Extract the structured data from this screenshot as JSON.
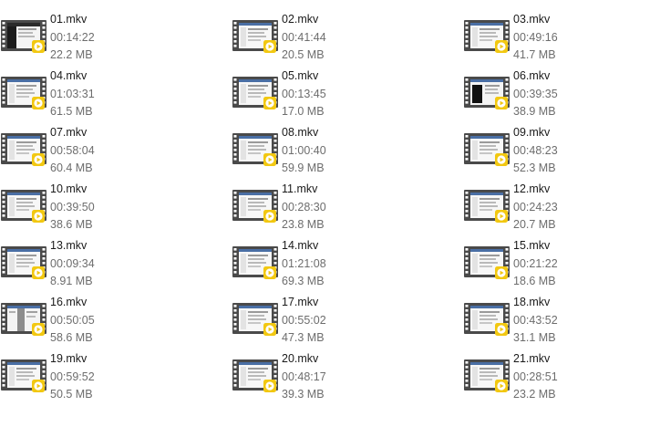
{
  "files": [
    {
      "name": "01.mkv",
      "duration": "00:14:22",
      "size": "22.2 MB",
      "thumb": "dark-mixed"
    },
    {
      "name": "02.mkv",
      "duration": "00:41:44",
      "size": "20.5 MB",
      "thumb": "light"
    },
    {
      "name": "03.mkv",
      "duration": "00:49:16",
      "size": "41.7 MB",
      "thumb": "light"
    },
    {
      "name": "04.mkv",
      "duration": "01:03:31",
      "size": "61.5 MB",
      "thumb": "light"
    },
    {
      "name": "05.mkv",
      "duration": "00:13:45",
      "size": "17.0 MB",
      "thumb": "light"
    },
    {
      "name": "06.mkv",
      "duration": "00:39:35",
      "size": "38.9 MB",
      "thumb": "dark-left"
    },
    {
      "name": "07.mkv",
      "duration": "00:58:04",
      "size": "60.4 MB",
      "thumb": "light"
    },
    {
      "name": "08.mkv",
      "duration": "01:00:40",
      "size": "59.9 MB",
      "thumb": "light"
    },
    {
      "name": "09.mkv",
      "duration": "00:48:23",
      "size": "52.3 MB",
      "thumb": "light"
    },
    {
      "name": "10.mkv",
      "duration": "00:39:50",
      "size": "38.6 MB",
      "thumb": "light"
    },
    {
      "name": "11.mkv",
      "duration": "00:28:30",
      "size": "23.8 MB",
      "thumb": "light"
    },
    {
      "name": "12.mkv",
      "duration": "00:24:23",
      "size": "20.7 MB",
      "thumb": "light"
    },
    {
      "name": "13.mkv",
      "duration": "00:09:34",
      "size": "8.91 MB",
      "thumb": "light"
    },
    {
      "name": "14.mkv",
      "duration": "01:21:08",
      "size": "69.3 MB",
      "thumb": "light"
    },
    {
      "name": "15.mkv",
      "duration": "00:21:22",
      "size": "18.6 MB",
      "thumb": "light"
    },
    {
      "name": "16.mkv",
      "duration": "00:50:05",
      "size": "58.6 MB",
      "thumb": "gray-mid"
    },
    {
      "name": "17.mkv",
      "duration": "00:55:02",
      "size": "47.3 MB",
      "thumb": "light"
    },
    {
      "name": "18.mkv",
      "duration": "00:43:52",
      "size": "31.1 MB",
      "thumb": "light"
    },
    {
      "name": "19.mkv",
      "duration": "00:59:52",
      "size": "50.5 MB",
      "thumb": "light"
    },
    {
      "name": "20.mkv",
      "duration": "00:48:17",
      "size": "39.3 MB",
      "thumb": "light"
    },
    {
      "name": "21.mkv",
      "duration": "00:28:51",
      "size": "23.2 MB",
      "thumb": "light"
    }
  ],
  "icons": {
    "tile_thumbnail": "video-film-thumbnail-icon",
    "play_badge": "play-badge-icon"
  },
  "colors": {
    "play_badge": "#f2c811",
    "film_strip": "#4a4a4a",
    "name_text": "#1a1a1a",
    "detail_text": "#6d6d6d"
  }
}
